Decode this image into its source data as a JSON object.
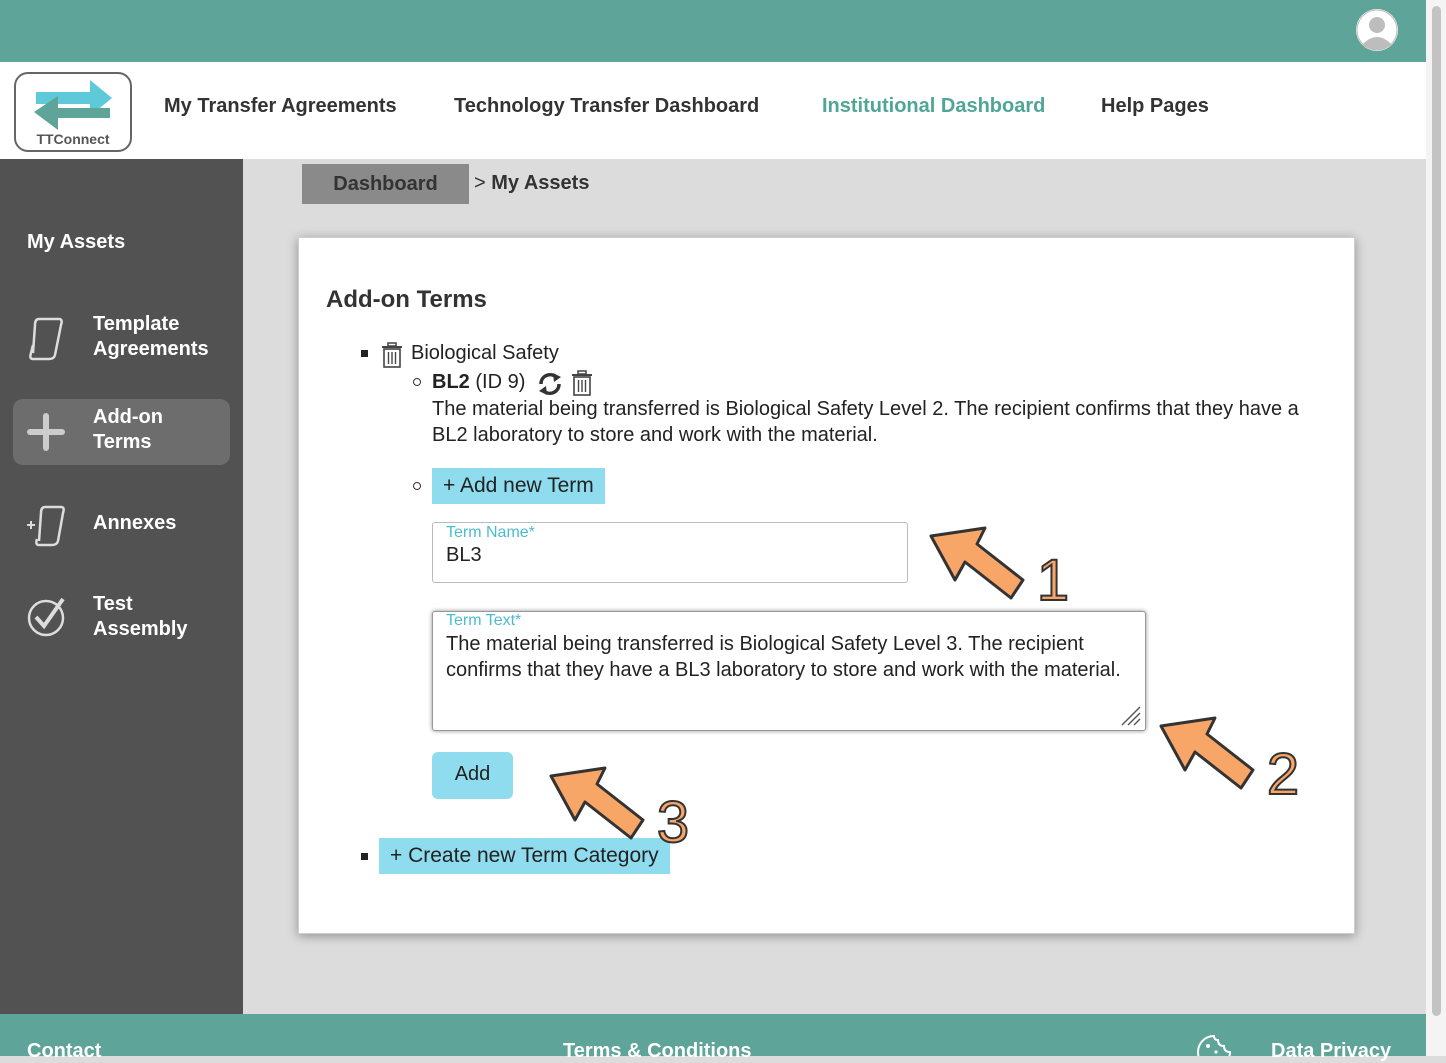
{
  "header": {
    "avatar_icon": "user-avatar-icon"
  },
  "logo": {
    "text": "TTConnect",
    "icon": "exchange-arrows-icon"
  },
  "nav": {
    "links": [
      {
        "label": "My Transfer Agreements",
        "active": false
      },
      {
        "label": "Technology Transfer Dashboard",
        "active": false
      },
      {
        "label": "Institutional Dashboard",
        "active": true
      },
      {
        "label": "Help Pages",
        "active": false
      }
    ]
  },
  "sidebar": {
    "title": "My Assets",
    "items": [
      {
        "line1": "Template",
        "line2": "Agreements",
        "icon": "scroll-icon",
        "active": false
      },
      {
        "line1": "Add-on",
        "line2": "Terms",
        "icon": "plus-icon",
        "active": true
      },
      {
        "line1": "Annexes",
        "line2": "",
        "icon": "scroll-plus-icon",
        "active": false
      },
      {
        "line1": "Test",
        "line2": "Assembly",
        "icon": "check-circle-icon",
        "active": false
      }
    ]
  },
  "breadcrumb": {
    "home": "Dashboard",
    "separator": ">",
    "current": "My Assets"
  },
  "main": {
    "title": "Add-on Terms",
    "category": {
      "name": "Biological Safety",
      "icon": "trash-icon"
    },
    "term": {
      "name": "BL2",
      "id_text": "(ID 9)",
      "icons": [
        "sync-icon",
        "trash-icon"
      ],
      "description": "The material being transferred is Biological Safety Level 2. The recipient confirms that they have a BL2 laboratory to store and work with the material."
    },
    "add_term_label": "+ Add new Term",
    "form": {
      "name_label": "Term Name*",
      "name_value": "BL3",
      "text_label": "Term Text*",
      "text_value": "The material being transferred is Biological Safety Level 3. The recipient confirms that they have a BL3 laboratory to store and work with the material.",
      "add_button": "Add"
    },
    "create_category_label": "+ Create new Term Category"
  },
  "annotations": {
    "labels": [
      "1",
      "2",
      "3"
    ],
    "color": "#f7a668"
  },
  "footer": {
    "links": [
      "Contact",
      "Terms & Conditions",
      "Data Privacy"
    ],
    "cookie_icon": "cookie-icon"
  },
  "colors": {
    "brand": "#5ea498",
    "accent_text": "#4fa696",
    "button": "#8fdcee",
    "sidebar": "#525252"
  }
}
